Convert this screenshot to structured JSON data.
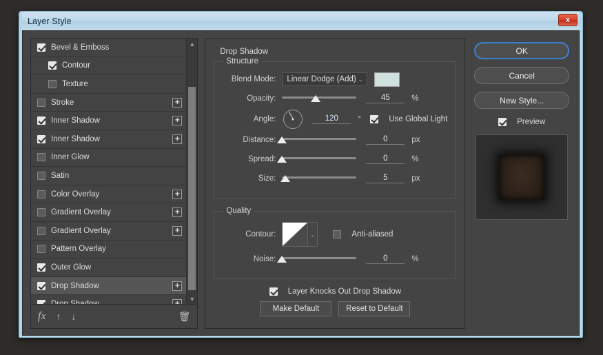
{
  "window": {
    "title": "Layer Style",
    "close_label": "x"
  },
  "effects": {
    "items": [
      {
        "label": "Bevel & Emboss",
        "checked": true,
        "indent": false,
        "add": false,
        "selected": false
      },
      {
        "label": "Contour",
        "checked": true,
        "indent": true,
        "add": false,
        "selected": false
      },
      {
        "label": "Texture",
        "checked": false,
        "indent": true,
        "add": false,
        "selected": false
      },
      {
        "label": "Stroke",
        "checked": false,
        "indent": false,
        "add": true,
        "selected": false
      },
      {
        "label": "Inner Shadow",
        "checked": true,
        "indent": false,
        "add": true,
        "selected": false
      },
      {
        "label": "Inner Shadow",
        "checked": true,
        "indent": false,
        "add": true,
        "selected": false
      },
      {
        "label": "Inner Glow",
        "checked": false,
        "indent": false,
        "add": false,
        "selected": false
      },
      {
        "label": "Satin",
        "checked": false,
        "indent": false,
        "add": false,
        "selected": false
      },
      {
        "label": "Color Overlay",
        "checked": false,
        "indent": false,
        "add": true,
        "selected": false
      },
      {
        "label": "Gradient Overlay",
        "checked": false,
        "indent": false,
        "add": true,
        "selected": false
      },
      {
        "label": "Gradient Overlay",
        "checked": false,
        "indent": false,
        "add": true,
        "selected": false
      },
      {
        "label": "Pattern Overlay",
        "checked": false,
        "indent": false,
        "add": false,
        "selected": false
      },
      {
        "label": "Outer Glow",
        "checked": true,
        "indent": false,
        "add": false,
        "selected": false
      },
      {
        "label": "Drop Shadow",
        "checked": true,
        "indent": false,
        "add": true,
        "selected": true
      },
      {
        "label": "Drop Shadow",
        "checked": true,
        "indent": false,
        "add": true,
        "selected": false
      }
    ],
    "toolbar": {
      "fx_label": "fx",
      "move_up_label": "↑",
      "move_down_label": "↓",
      "delete_label": "🗑"
    },
    "scroll": {
      "up_arrow": "▲",
      "down_arrow": "▼"
    }
  },
  "settings": {
    "group_title": "Drop Shadow",
    "structure": {
      "legend": "Structure",
      "blend_mode": {
        "label": "Blend Mode:",
        "value": "Linear Dodge (Add)",
        "caret": "⌄",
        "color": "#cfe0dd"
      },
      "opacity": {
        "label": "Opacity:",
        "value": "45",
        "unit": "%",
        "percent": 45
      },
      "angle": {
        "label": "Angle:",
        "value": "120",
        "unit": "°",
        "degrees": 120,
        "global_light_label": "Use Global Light",
        "global_light_checked": true
      },
      "distance": {
        "label": "Distance:",
        "value": "0",
        "unit": "px",
        "percent": 0
      },
      "spread": {
        "label": "Spread:",
        "value": "0",
        "unit": "%",
        "percent": 0
      },
      "size": {
        "label": "Size:",
        "value": "5",
        "unit": "px",
        "percent": 4
      }
    },
    "quality": {
      "legend": "Quality",
      "contour": {
        "label": "Contour:",
        "caret": "⌄"
      },
      "anti_aliased": {
        "label": "Anti-aliased",
        "checked": false
      },
      "noise": {
        "label": "Noise:",
        "value": "0",
        "unit": "%",
        "percent": 0
      }
    },
    "knockout": {
      "label": "Layer Knocks Out Drop Shadow",
      "checked": true
    },
    "buttons": {
      "make_default": "Make Default",
      "reset_to_default": "Reset to Default"
    }
  },
  "actions": {
    "ok": "OK",
    "cancel": "Cancel",
    "new_style": "New Style...",
    "preview": {
      "label": "Preview",
      "checked": true
    }
  }
}
